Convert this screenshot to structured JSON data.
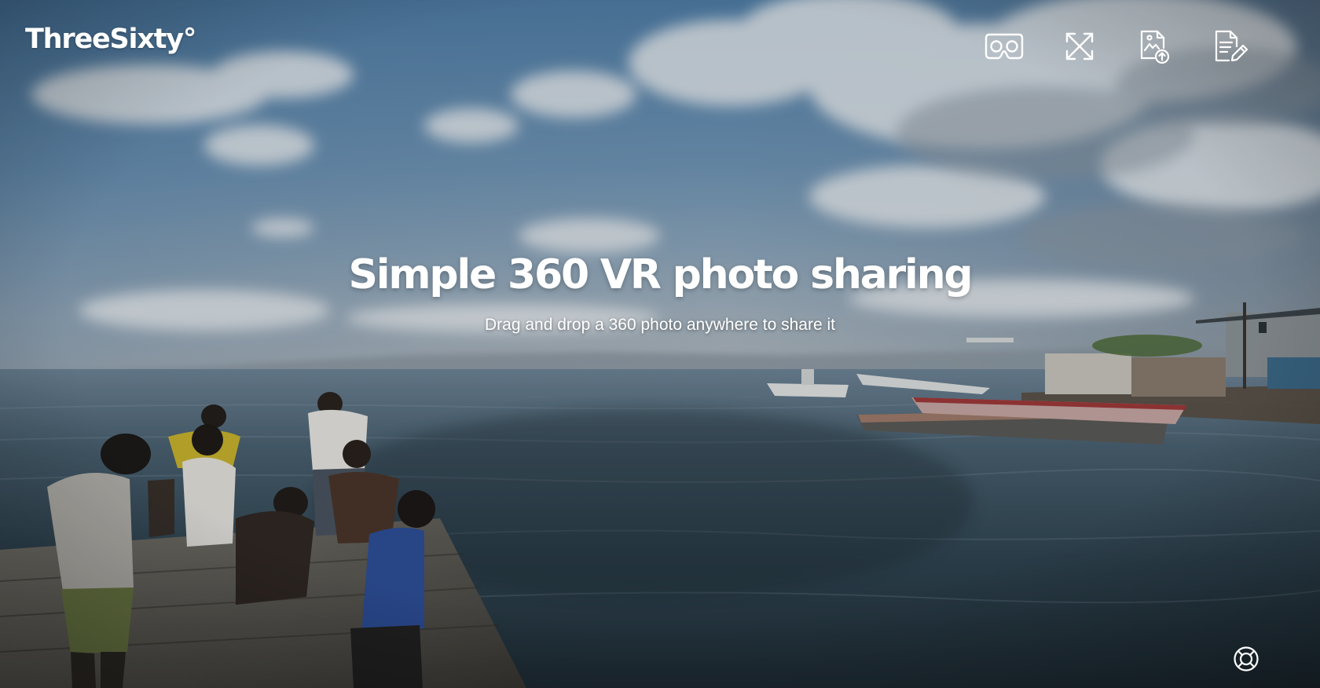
{
  "app": {
    "logo": "ThreeSixty°"
  },
  "toolbar": {
    "items": [
      {
        "name": "vr-headset-icon",
        "label": "VR mode"
      },
      {
        "name": "fullscreen-icon",
        "label": "Fullscreen"
      },
      {
        "name": "upload-photo-icon",
        "label": "Upload photo"
      },
      {
        "name": "edit-document-icon",
        "label": "Edit details"
      }
    ]
  },
  "hero": {
    "title": "Simple 360 VR photo sharing",
    "subtitle": "Drag and drop a 360 photo anywhere to share it"
  },
  "help": {
    "icon": "lifebuoy-icon"
  },
  "colors": {
    "text": "#ffffff",
    "sky": "#5d87ad",
    "water": "#2b3f4c"
  }
}
